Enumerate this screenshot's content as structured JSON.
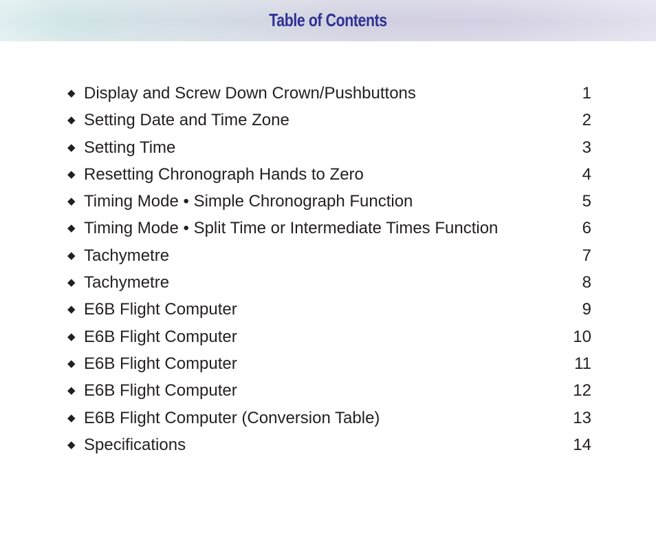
{
  "header": {
    "title": "Table of Contents"
  },
  "toc": {
    "bullet_icon": "◆",
    "items": [
      {
        "label": "Display and Screw Down Crown/Pushbuttons",
        "page": "1"
      },
      {
        "label": "Setting Date and Time Zone",
        "page": "2"
      },
      {
        "label": "Setting Time",
        "page": "3"
      },
      {
        "label": "Resetting Chronograph Hands to Zero",
        "page": "4"
      },
      {
        "label": "Timing Mode • Simple Chronograph Function",
        "page": "5"
      },
      {
        "label": "Timing Mode • Split Time or Intermediate Times Function",
        "page": "6"
      },
      {
        "label": "Tachymetre",
        "page": "7"
      },
      {
        "label": "Tachymetre",
        "page": "8"
      },
      {
        "label": "E6B Flight Computer",
        "page": "9"
      },
      {
        "label": "E6B Flight Computer",
        "page": "10"
      },
      {
        "label": "E6B Flight Computer",
        "page": "11"
      },
      {
        "label": "E6B Flight Computer",
        "page": "12"
      },
      {
        "label": "E6B Flight Computer (Conversion Table)",
        "page": "13"
      },
      {
        "label": "Specifications",
        "page": "14"
      }
    ]
  },
  "colors": {
    "title": "#2e3192",
    "text": "#231f20"
  }
}
